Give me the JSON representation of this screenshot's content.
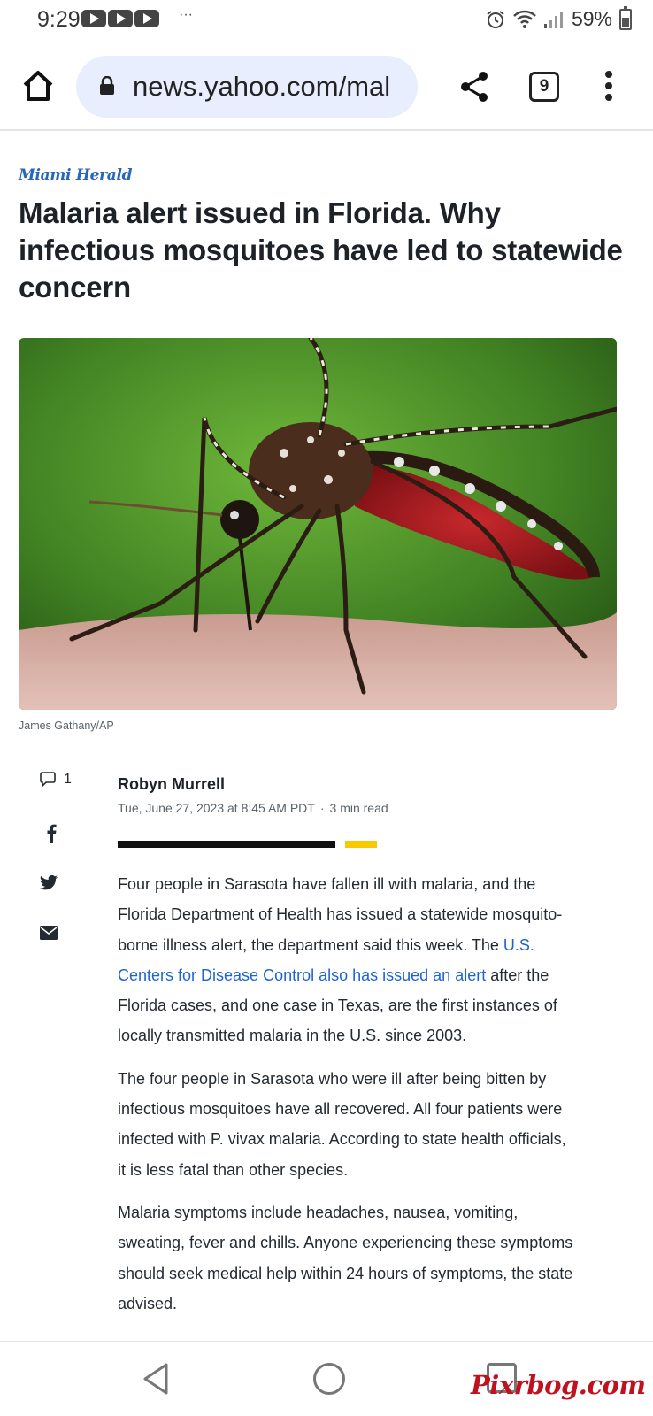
{
  "status_bar": {
    "time": "9:29",
    "dots": "···",
    "battery_percent": "59%",
    "icons": [
      "youtube-icon",
      "youtube-icon",
      "youtube-icon",
      "alarm-icon",
      "wifi-icon",
      "signal-icon",
      "battery-icon"
    ]
  },
  "browser": {
    "url": "news.yahoo.com/mal",
    "tab_count": "9",
    "icons": [
      "home-icon",
      "lock-icon",
      "share-icon",
      "tabs-icon",
      "more-vert-icon"
    ]
  },
  "article": {
    "publisher": "Miami Herald",
    "headline": "Malaria alert issued in Florida. Why infectious mosquitoes have led to statewide concern",
    "image_credit": "James Gathany/AP",
    "comment_count": "1",
    "author": "Robyn Murrell",
    "date": "Tue, June 27, 2023 at 8:45 AM PDT",
    "read_time": "3 min read",
    "meta_separator": "·",
    "paragraph1_before": "Four people in Sarasota have fallen ill with malaria, and the Florida Department of Health has issued a statewide mosquito-borne illness alert, the department said this week. The ",
    "paragraph1_link": "U.S. Centers for Disease Control also has issued an alert",
    "paragraph1_after": " after the Florida cases, and one case in Texas, are the first instances of locally transmitted malaria in the U.S. since 2003.",
    "paragraph2": "The four people in Sarasota who were ill after being bitten by infectious mosquitoes have all recovered. All four patients were infected with P. vivax malaria. According to state health officials, it is less fatal than other species.",
    "paragraph3": "Malaria symptoms include headaches, nausea, vomiting, sweating, fever and chills. Anyone experiencing these symptoms should seek medical help within 24 hours of symptoms, the state advised."
  },
  "nav": {
    "icons": [
      "back-icon",
      "home-circle-icon",
      "recents-icon"
    ]
  },
  "watermark": "Pixrbog.com",
  "colors": {
    "link": "#1e63d6",
    "url_bar": "#e8eefd",
    "progress_accent": "#f6c900",
    "publisher": "#2867b7"
  }
}
